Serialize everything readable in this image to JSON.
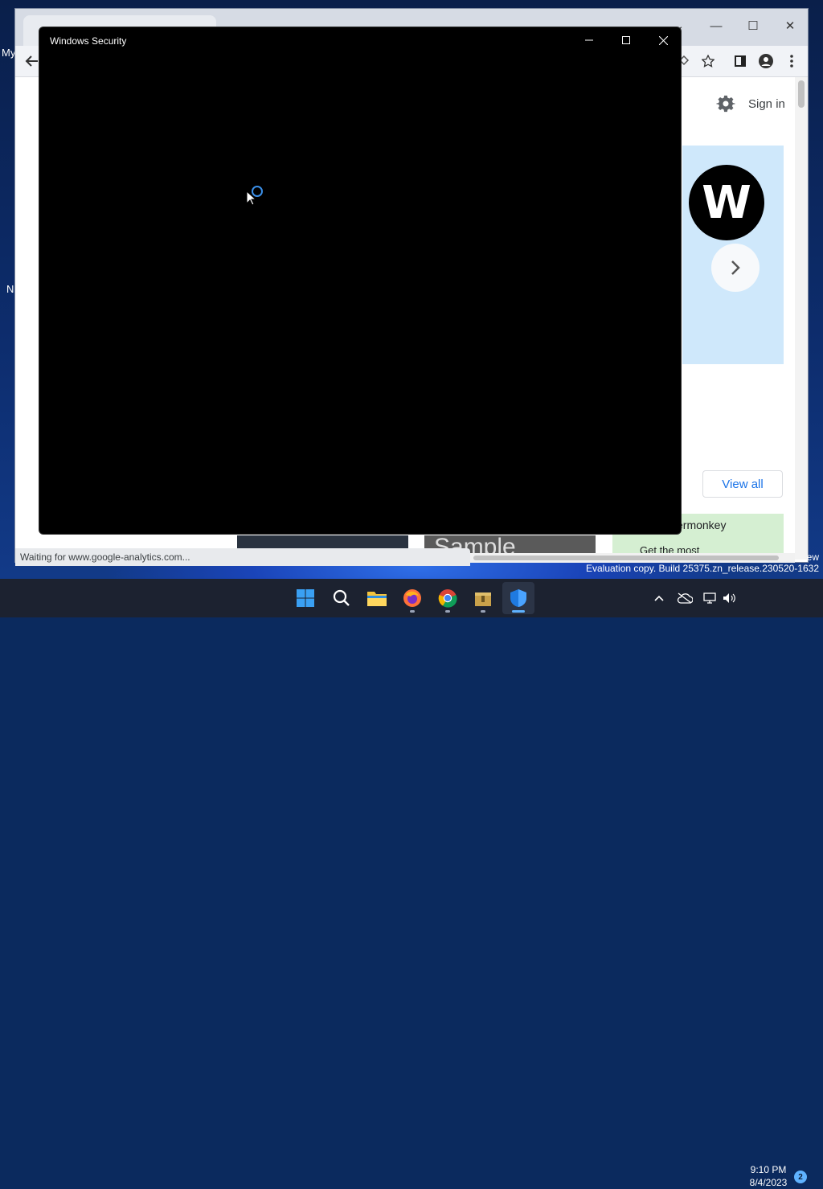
{
  "desktop": {
    "labels": [
      "My",
      "N"
    ]
  },
  "browser": {
    "sign_in": "Sign in",
    "view_all": "View all",
    "tampermonkey_title": "ermonkey",
    "tampermonkey_sub": "Get the most",
    "sample_card_text": "Sample",
    "status_text": "Waiting for www.google-analytics.com..."
  },
  "security_window": {
    "title": "Windows Security",
    "state": "loading"
  },
  "watermark": {
    "line1": "ew",
    "line2": "Evaluation copy. Build 25375.zn_release.230520-1632"
  },
  "taskbar": {
    "apps": [
      "start-icon",
      "search-icon",
      "file-explorer-icon",
      "firefox-icon",
      "chrome-icon",
      "archive-icon",
      "windows-security-icon"
    ],
    "active_app": "windows-security-icon",
    "time": "9:10 PM",
    "date": "8/4/2023",
    "notification_count": "2"
  },
  "colors": {
    "accent": "#3b8fe8",
    "taskbar": "#1c2230",
    "window_bg": "#000000"
  }
}
